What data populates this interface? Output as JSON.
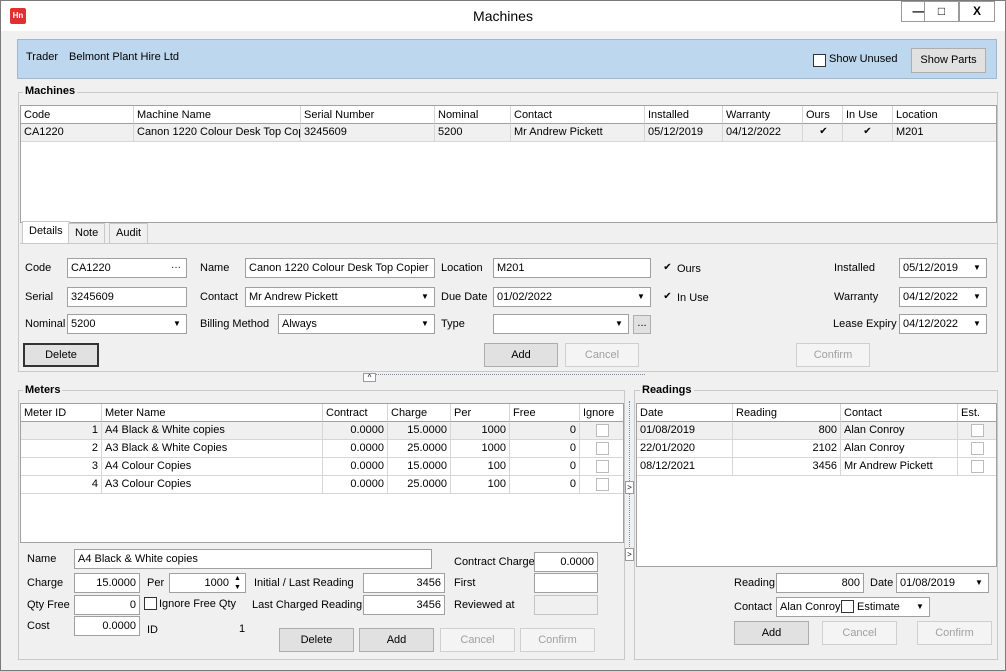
{
  "window": {
    "title": "Machines",
    "minimize_label": "—",
    "maximize_label": "□",
    "close_label": "X",
    "app_icon_label": "Hn"
  },
  "trader": {
    "label": "Trader",
    "value": "Belmont Plant Hire Ltd",
    "show_unused_label": "Show Unused",
    "show_parts_label": "Show Parts"
  },
  "machines": {
    "group_label": "Machines",
    "columns": [
      "Code",
      "Machine Name",
      "Serial Number",
      "Nominal",
      "Contact",
      "Installed",
      "Warranty",
      "Ours",
      "In Use",
      "Location"
    ],
    "rows": [
      {
        "code": "CA1220",
        "name": "Canon 1220 Colour Desk Top Cop",
        "serial": "3245609",
        "nominal": "5200",
        "contact": "Mr Andrew Pickett",
        "installed": "05/12/2019",
        "warranty": "04/12/2022",
        "ours": true,
        "in_use": true,
        "location": "M201"
      }
    ]
  },
  "tabs": [
    "Details",
    "Note",
    "Audit"
  ],
  "details": {
    "code_label": "Code",
    "code_value": "CA1220",
    "ellipsis": "···",
    "serial_label": "Serial",
    "serial_value": "3245609",
    "nominal_label": "Nominal",
    "nominal_value": "5200",
    "name_label": "Name",
    "name_value": "Canon 1220 Colour Desk Top Copier",
    "contact_label": "Contact",
    "contact_value": "Mr Andrew Pickett",
    "billing_label": "Billing Method",
    "billing_value": "Always",
    "location_label": "Location",
    "location_value": "M201",
    "due_date_label": "Due Date",
    "due_date_value": "01/02/2022",
    "type_label": "Type",
    "type_value": "",
    "type_button": "...",
    "ours_label": "Ours",
    "in_use_label": "In Use",
    "installed_label": "Installed",
    "installed_value": "05/12/2019",
    "warranty_label": "Warranty",
    "warranty_value": "04/12/2022",
    "lease_label": "Lease Expiry",
    "lease_value": "04/12/2022",
    "delete_label": "Delete",
    "add_label": "Add",
    "cancel_label": "Cancel",
    "confirm_label": "Confirm"
  },
  "meters": {
    "group_label": "Meters",
    "columns": [
      "Meter ID",
      "Meter Name",
      "Contract",
      "Charge",
      "Per",
      "Free",
      "Ignore"
    ],
    "rows": [
      {
        "id": "1",
        "name": "A4 Black & White copies",
        "contract": "0.0000",
        "charge": "15.0000",
        "per": "1000",
        "free": "0"
      },
      {
        "id": "2",
        "name": "A3 Black & White Copies",
        "contract": "0.0000",
        "charge": "25.0000",
        "per": "1000",
        "free": "0"
      },
      {
        "id": "3",
        "name": "A4 Colour Copies",
        "contract": "0.0000",
        "charge": "15.0000",
        "per": "100",
        "free": "0"
      },
      {
        "id": "4",
        "name": "A3 Colour Copies",
        "contract": "0.0000",
        "charge": "25.0000",
        "per": "100",
        "free": "0"
      }
    ],
    "name_label": "Name",
    "name_value": "A4 Black & White copies",
    "charge_label": "Charge",
    "charge_value": "15.0000",
    "per_label": "Per",
    "per_value": "1000",
    "qty_free_label": "Qty Free",
    "qty_free_value": "0",
    "ignore_free_label": "Ignore Free Qty",
    "cost_label": "Cost",
    "cost_value": "0.0000",
    "id_label": "ID",
    "id_value": "1",
    "initial_last_label": "Initial / Last Reading",
    "initial_last_value": "3456",
    "last_charged_label": "Last Charged Reading",
    "last_charged_value": "3456",
    "contract_charge_label": "Contract Charge",
    "contract_charge_value": "0.0000",
    "first_label": "First",
    "reviewed_label": "Reviewed at",
    "delete_label": "Delete",
    "add_label": "Add",
    "cancel_label": "Cancel",
    "confirm_label": "Confirm"
  },
  "readings": {
    "group_label": "Readings",
    "columns": [
      "Date",
      "Reading",
      "Contact",
      "Est."
    ],
    "rows": [
      {
        "date": "01/08/2019",
        "reading": "800",
        "contact": "Alan Conroy"
      },
      {
        "date": "22/01/2020",
        "reading": "2102",
        "contact": "Alan Conroy"
      },
      {
        "date": "08/12/2021",
        "reading": "3456",
        "contact": "Mr Andrew Pickett"
      }
    ],
    "reading_label": "Reading",
    "reading_value": "800",
    "date_label": "Date",
    "date_value": "01/08/2019",
    "contact_label": "Contact",
    "contact_value": "Alan Conroy",
    "estimate_label": "Estimate",
    "add_label": "Add",
    "cancel_label": "Cancel",
    "confirm_label": "Confirm"
  },
  "splitter": {
    "up_label": "^",
    "right_label": ">"
  }
}
